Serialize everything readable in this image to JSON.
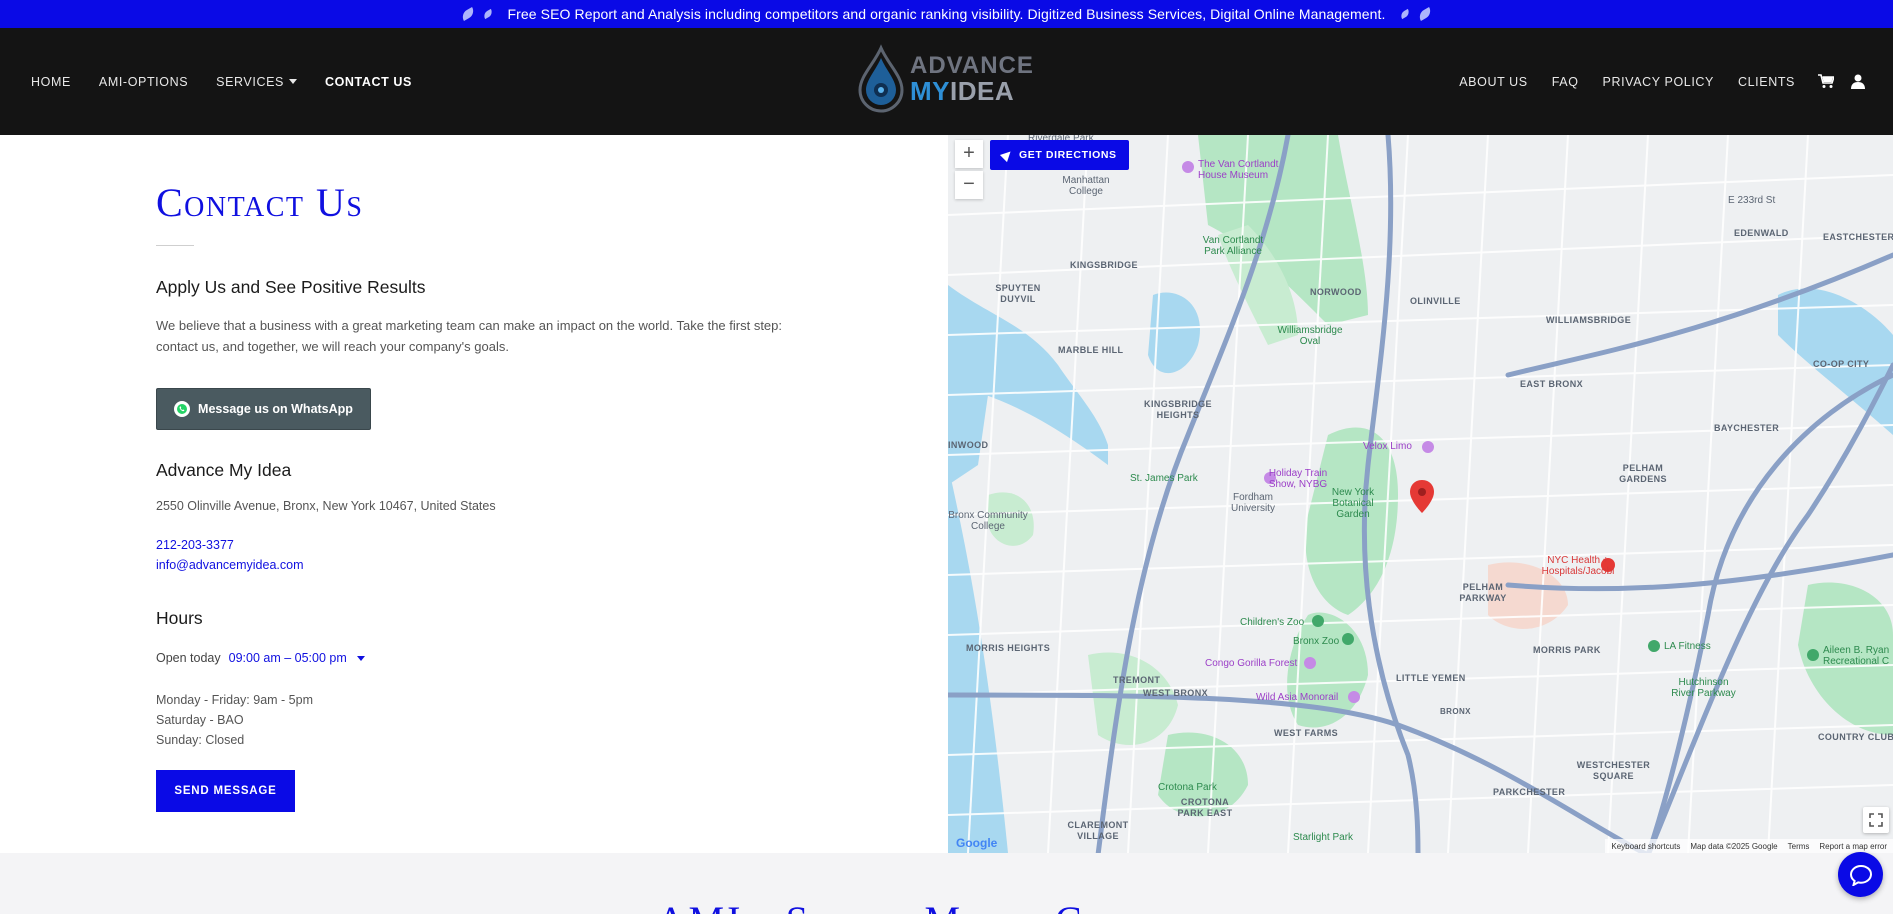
{
  "announcement": {
    "text": "Free SEO Report and Analysis including competitors and organic ranking visibility. Digitized Business Services, Digital Online Management."
  },
  "nav": {
    "left": [
      "HOME",
      "AMI-OPTIONS",
      "SERVICES",
      "CONTACT US"
    ],
    "right": [
      "ABOUT US",
      "FAQ",
      "PRIVACY POLICY",
      "CLIENTS"
    ],
    "active": "CONTACT US"
  },
  "logo": {
    "line1": "ADVANCE",
    "line2a": "MY",
    "line2b": "IDEA"
  },
  "contact": {
    "title": "Contact Us",
    "subtitle": "Apply Us and See Positive Results",
    "intro": "We believe that a business with a great marketing team can make an impact on the world. Take the first step: contact us, and together, we will reach your company's goals.",
    "whatsapp_label": "Message us on WhatsApp",
    "company": "Advance My Idea",
    "address": "2550 Olinville Avenue, Bronx, New York 10467, United States",
    "phone": "212-203-3377",
    "email": "info@advancemyidea.com"
  },
  "hours": {
    "heading": "Hours",
    "open_label": "Open today",
    "today": "09:00 am – 05:00 pm",
    "lines": [
      "Monday - Friday: 9am - 5pm",
      "Saturday - BAO",
      "Sunday: Closed"
    ]
  },
  "send_label": "SEND MESSAGE",
  "map": {
    "directions_label": "GET DIRECTIONS",
    "zoom_in": "+",
    "zoom_out": "−",
    "google": "Google",
    "footer": [
      "Keyboard shortcuts",
      "Map data ©2025 Google",
      "Terms",
      "Report a map error"
    ],
    "labels": {
      "riverdale": "Riverdale Park",
      "vancortlandt": "The Van Cortlandt House Museum",
      "manhattan_college": "Manhattan College",
      "vc_alliance": "Van Cortlandt Park Alliance",
      "e233": "E 233rd St",
      "edenwald": "EDENWALD",
      "eastchester": "EASTCHESTER",
      "kingsbridge": "KINGSBRIDGE",
      "spuyten": "SPUYTEN DUYVIL",
      "norwood": "NORWOOD",
      "olinville": "OLINVILLE",
      "williamsbridge": "WILLIAMSBRIDGE",
      "coop": "CO-OP CITY",
      "marblehill": "MARBLE HILL",
      "wb_oval": "Williamsbridge Oval",
      "eastbronx": "EAST BRONX",
      "kb_heights": "KINGSBRIDGE HEIGHTS",
      "baychester": "BAYCHESTER",
      "velox": "Velox Limo",
      "inwood": "INWOOD",
      "holiday_train": "Holiday Train Show, NYBG",
      "stjames": "St. James Park",
      "fordham": "Fordham University",
      "nybg": "New York Botanical Garden",
      "pelham_gardens": "PELHAM GARDENS",
      "bcc": "Bronx Community College",
      "nyc_health": "NYC Health + Hospitals/Jacobi",
      "pelham_parkway": "PELHAM PARKWAY",
      "childrens_zoo": "Children's Zoo",
      "bronx_zoo": "Bronx Zoo",
      "morris_heights": "MORRIS HEIGHTS",
      "morris_park": "MORRIS PARK",
      "la_fitness": "LA Fitness",
      "aileen": "Aileen B. Ryan Recreational C",
      "congo": "Congo Gorilla Forest",
      "tremont": "TREMONT",
      "west_bronx": "WEST BRONX",
      "little_yemen": "LITTLE YEMEN",
      "hutchinson": "Hutchinson River Parkway",
      "wild_asia": "Wild Asia Monorail",
      "west_farms": "WEST FARMS",
      "country_club": "COUNTRY CLUB",
      "westchester_sq": "WESTCHESTER SQUARE",
      "parkchester": "PARKCHESTER",
      "crotona_park": "Crotona Park",
      "crotona_east": "CROTONA PARK EAST",
      "claremont": "CLAREMONT VILLAGE",
      "starlight": "Starlight Park",
      "bronx": "BRONX"
    }
  },
  "bottom": {
    "title": "AMI - Social Media Channels"
  },
  "colors": {
    "brand_blue": "#0a0ae6",
    "header_bg": "#141414",
    "whatsapp_btn": "#4a5a60"
  }
}
